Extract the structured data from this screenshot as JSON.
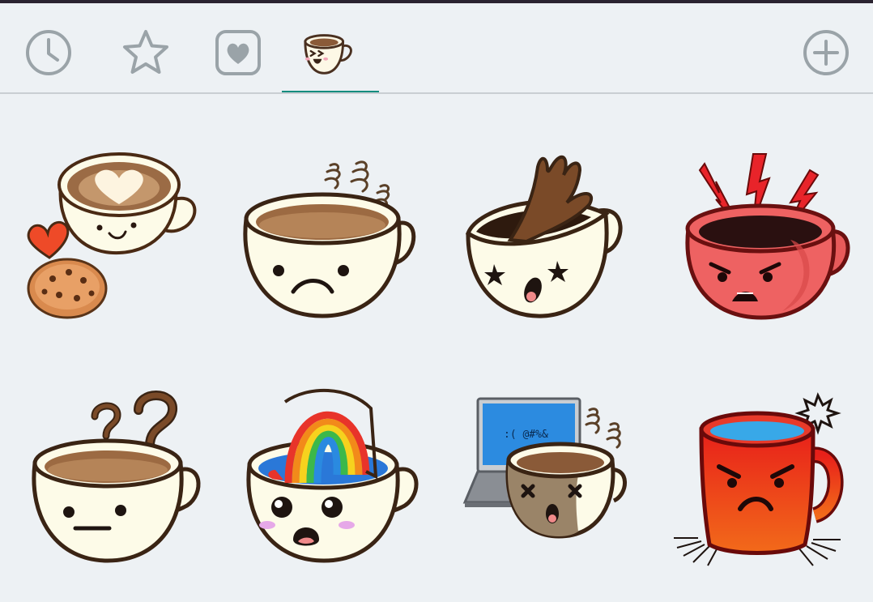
{
  "colors": {
    "background": "#edf1f4",
    "accent": "#118c7e",
    "icon_gray": "#9aa3a8"
  },
  "tabs": [
    {
      "icon": "clock-icon",
      "name": "recent"
    },
    {
      "icon": "star-icon",
      "name": "favorites"
    },
    {
      "icon": "heart-icon",
      "name": "loved"
    },
    {
      "icon": "coffee-cup-sticker-pack-icon",
      "name": "coffee-pack",
      "selected": true
    },
    {
      "icon": "plus-circle-icon",
      "name": "add-sticker-pack"
    }
  ],
  "stickers": [
    {
      "name": "latte-heart-cookie",
      "icon": "latte-art-cup-with-cookie-and-heart"
    },
    {
      "name": "sad-steaming-cup",
      "icon": "sad-cup-with-steam"
    },
    {
      "name": "spilling-cup-dizzy",
      "icon": "cup-spilling-dizzy-eyes"
    },
    {
      "name": "angry-red-lightning",
      "icon": "angry-red-cup-with-lightning"
    },
    {
      "name": "confused-question-cup",
      "icon": "cup-with-question-marks"
    },
    {
      "name": "rainbow-surprised-cup",
      "icon": "cup-with-rainbow-surprised"
    },
    {
      "name": "laptop-broken-cup",
      "icon": "laptop-with-dazed-cup"
    },
    {
      "name": "furious-red-mug",
      "icon": "furious-red-mug-burning"
    }
  ],
  "laptop_screen_text": ":( @#%&"
}
